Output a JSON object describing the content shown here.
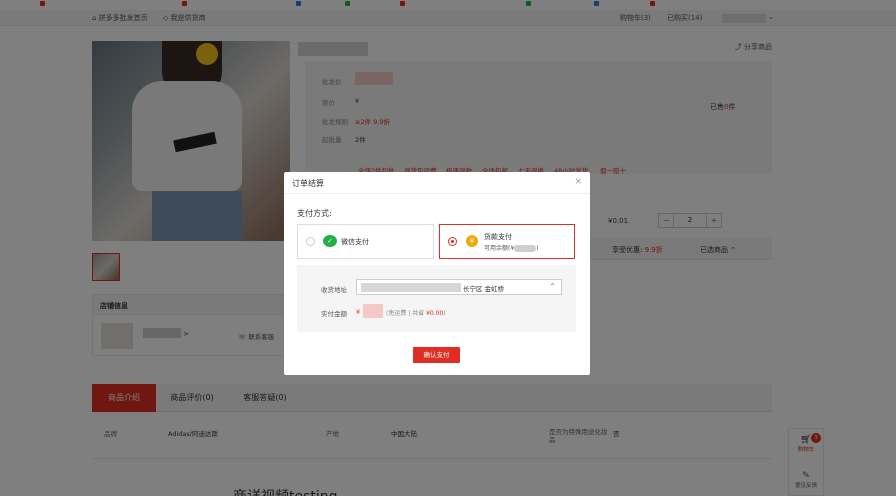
{
  "nav": {
    "home": "拼多多批发首页",
    "supply": "我是供货商",
    "cart_label": "购物车",
    "cart_count": "(3)",
    "bought": "已购买(14)"
  },
  "product": {
    "share": "分享商品",
    "rows": [
      {
        "label": "批发价",
        "value": ""
      },
      {
        "label": "原价",
        "value": "¥"
      },
      {
        "label": "批发规则",
        "value": "≥2件 9.9折"
      },
      {
        "label": "起批量",
        "value": "2件"
      }
    ],
    "sold_prefix": "已售",
    "sold_count": "0",
    "sold_suffix": "件",
    "promos": [
      "全场2件起批",
      "退货包运费",
      "极速退款",
      "全场包邮",
      "七天退换",
      "48小时发货",
      "假一赔十"
    ],
    "unit_price": "¥0.01",
    "qty": "2",
    "discount_label": "享受优惠:",
    "discount_value": "9.9折",
    "selected_label": "已选商品"
  },
  "store": {
    "title": "店铺信息",
    "arrow": ">",
    "contact": "联系客服"
  },
  "tabs": [
    {
      "label": "商品介绍"
    },
    {
      "label": "商品评价(0)"
    },
    {
      "label": "客服答疑(0)"
    }
  ],
  "specs": [
    {
      "k": "品牌",
      "v": "Adidas/阿迪达斯"
    },
    {
      "k": "产地",
      "v": "中国大陆"
    },
    {
      "k": "是否为特殊用途化妆品",
      "v": "否"
    }
  ],
  "video_title": "商详视频testing",
  "sidebar": {
    "cart_badge": "3",
    "cart_label": "购物车",
    "feedback_label": "意见反馈"
  },
  "modal": {
    "title": "订单结算",
    "close": "×",
    "pay_label": "支付方式:",
    "wechat_label": "微信支付",
    "balance_title": "货款支付",
    "balance_sub": "可用余额(¥",
    "balance_sub_end": ")",
    "addr_label": "收货地址",
    "addr_text": "长宁区 金虹桥",
    "amount_label": "实付金额",
    "amount_currency": "¥",
    "amount_note_prefix": "(免运费",
    "amount_note_mid": " | 共省 ",
    "amount_note_value": "¥0.00",
    "amount_note_suffix": ")",
    "confirm": "确认支付"
  },
  "colors": {
    "accent": "#e02e24",
    "wechat": "#22b04b",
    "coin": "#f0a80a"
  }
}
